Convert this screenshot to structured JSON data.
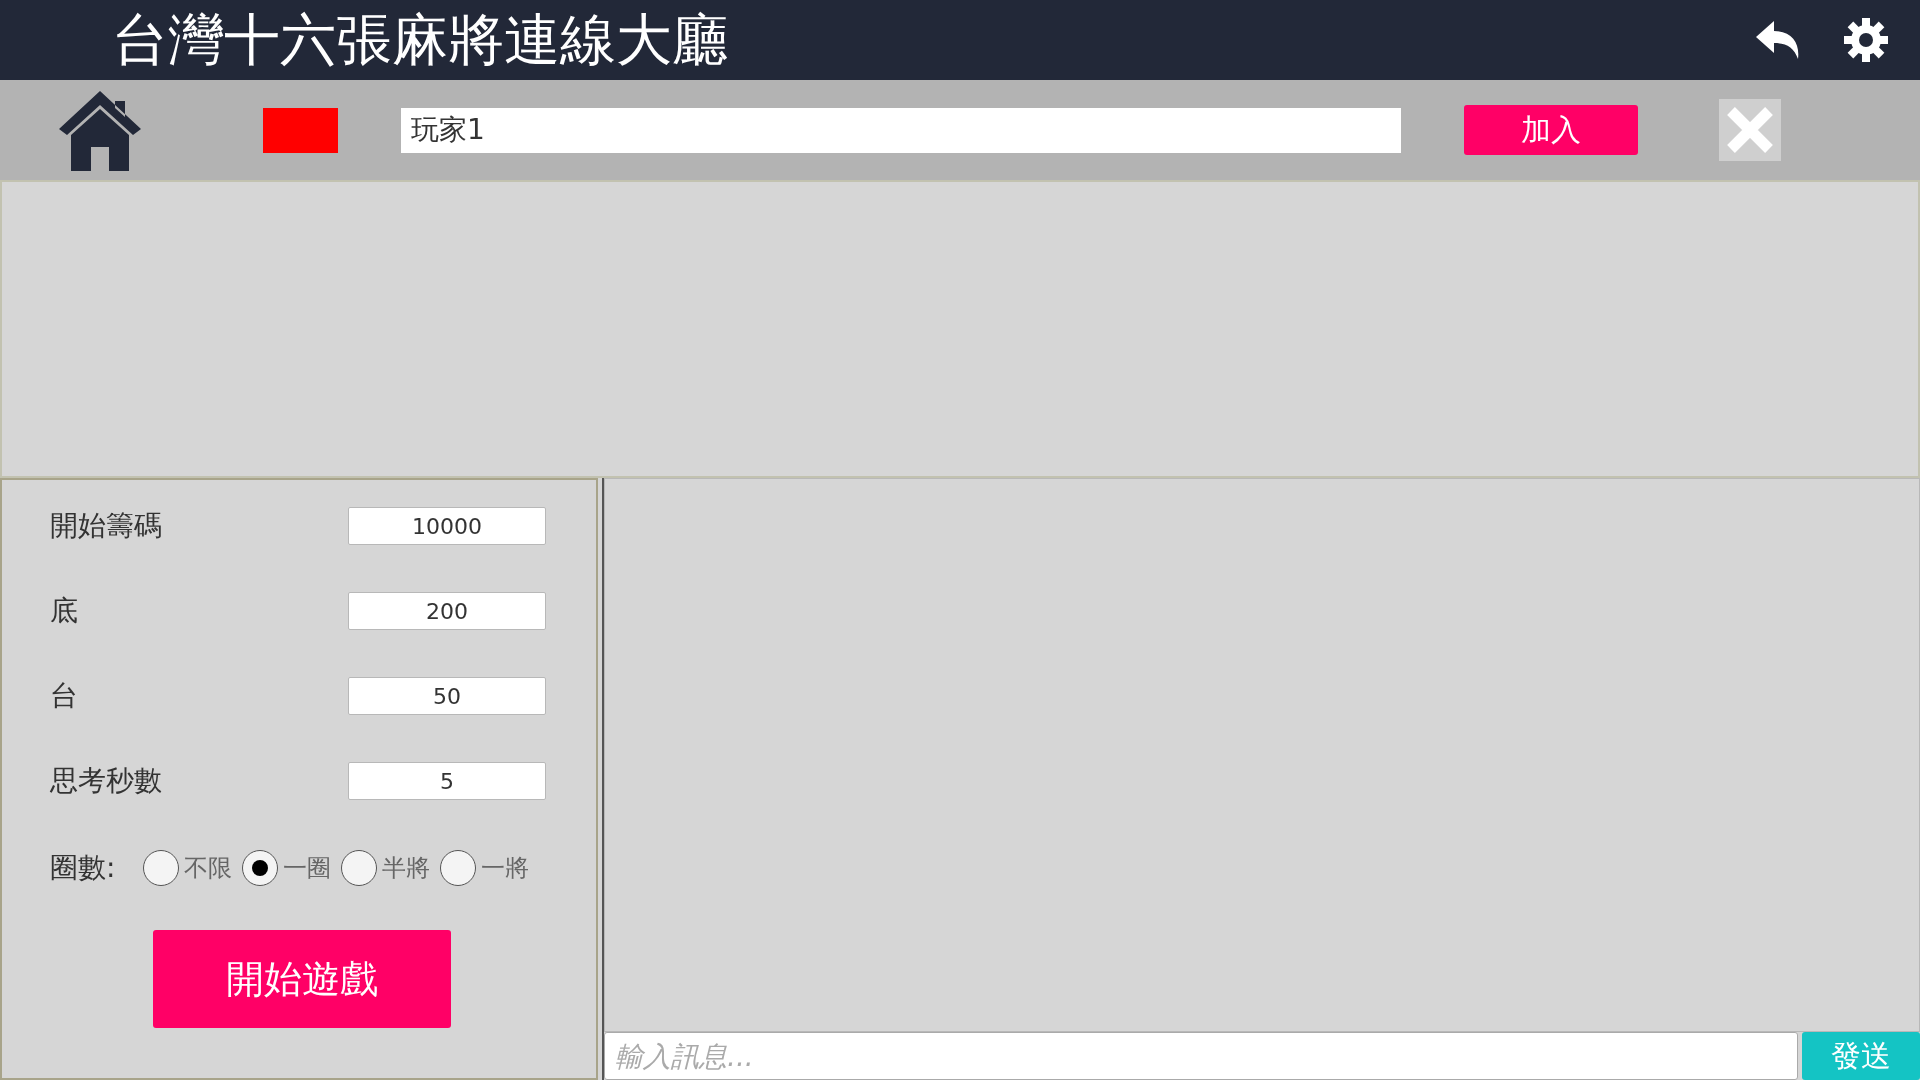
{
  "header": {
    "title": "台灣十六張麻將連線大廳"
  },
  "player_bar": {
    "color": "#ff0000",
    "name_value": "玩家1",
    "join_button": "加入"
  },
  "settings": [
    {
      "label": "開始籌碼",
      "value": "10000"
    },
    {
      "label": "底",
      "value": "200"
    },
    {
      "label": "台",
      "value": "50"
    },
    {
      "label": "思考秒數",
      "value": "5"
    }
  ],
  "rounds": {
    "label": "圈數:",
    "options": [
      {
        "label": "不限",
        "selected": false
      },
      {
        "label": "一圈",
        "selected": true
      },
      {
        "label": "半將",
        "selected": false
      },
      {
        "label": "一將",
        "selected": false
      }
    ]
  },
  "start_button": "開始遊戲",
  "chat": {
    "placeholder": "輸入訊息...",
    "send_button": "發送"
  }
}
